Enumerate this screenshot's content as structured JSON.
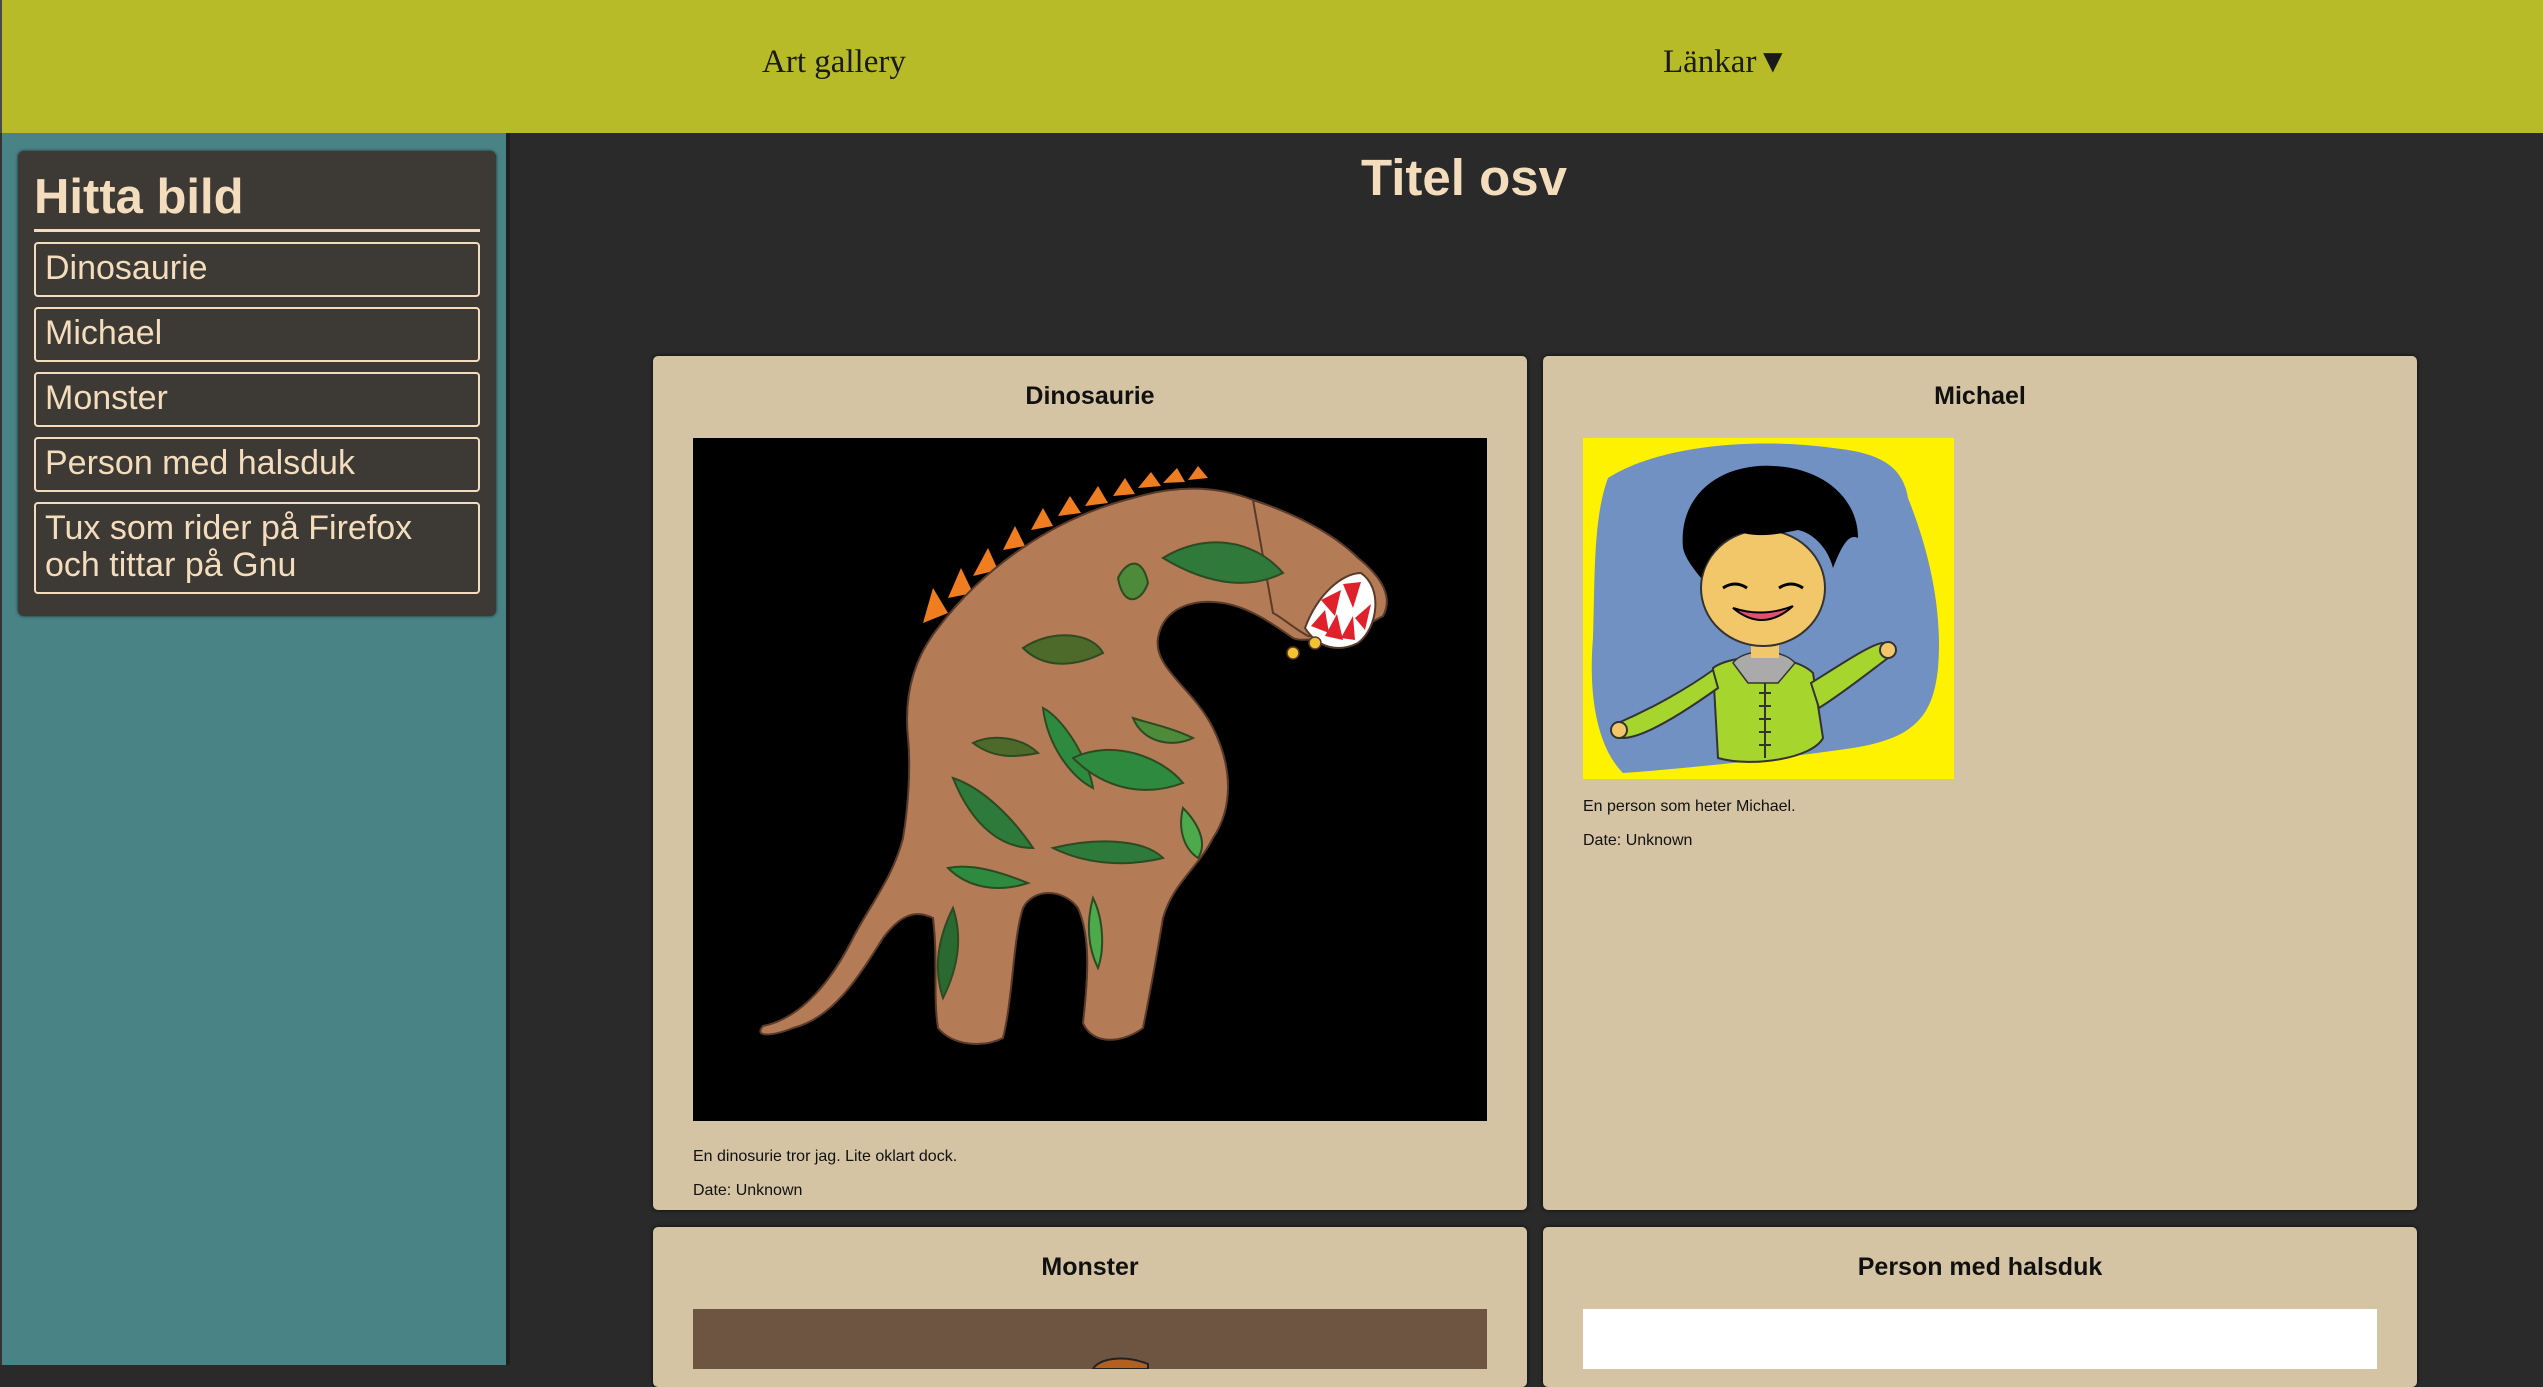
{
  "header": {
    "gallery_link": "Art gallery",
    "links_menu": "Länkar▼"
  },
  "sidebar": {
    "title": "Hitta bild",
    "items": [
      "Dinosaurie",
      "Michael",
      "Monster",
      "Person med halsduk",
      "Tux som rider på Firefox och tittar på Gnu"
    ]
  },
  "main": {
    "title": "Titel osv",
    "cards": [
      {
        "title": "Dinosaurie",
        "description": "En dinosurie tror jag. Lite oklart dock.",
        "date": "Date: Unknown"
      },
      {
        "title": "Michael",
        "description": "En person som heter Michael.",
        "date": "Date: Unknown"
      },
      {
        "title": "Monster"
      },
      {
        "title": "Person med halsduk"
      }
    ]
  },
  "colors": {
    "header_bg": "#b8bb28",
    "sidebar_bg": "#4a8385",
    "panel_bg": "#3d3935",
    "accent_text": "#f3ddbd",
    "card_bg": "#d4c4a3",
    "page_bg": "#2a2a2a"
  }
}
